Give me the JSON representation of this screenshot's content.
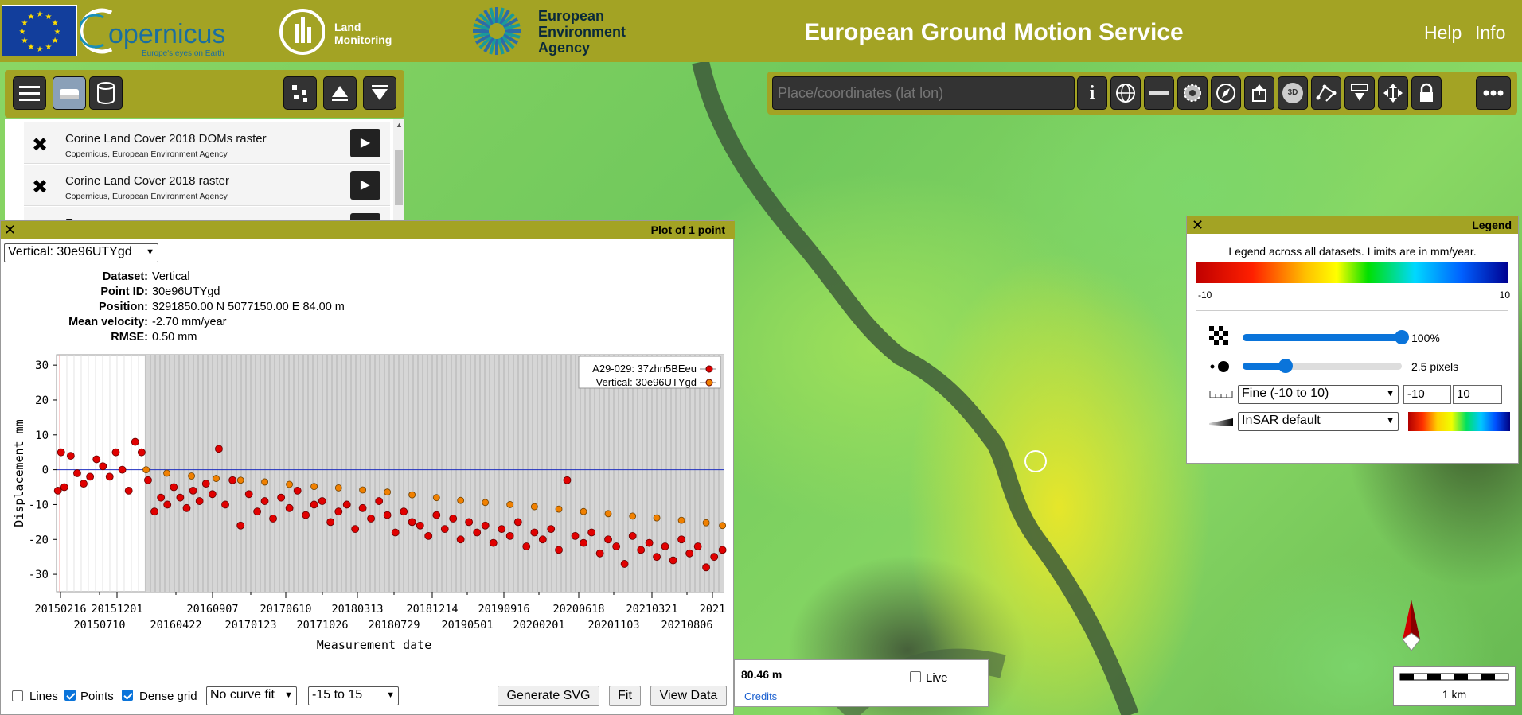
{
  "header": {
    "logo_eu": "EU",
    "logo_copernicus": "opernicus",
    "logo_copernicus_tagline": "Europe's eyes on Earth",
    "logo_land": "Land\nMonitoring",
    "logo_eea_line1": "European",
    "logo_eea_line2": "Environment",
    "logo_eea_line3": "Agency",
    "title": "European Ground Motion Service",
    "help": "Help",
    "info": "Info"
  },
  "search": {
    "placeholder": "Place/coordinates (lat lon)"
  },
  "toolbar_right": {
    "three_d_label": "3D"
  },
  "layers": [
    {
      "title": "Corine Land Cover 2018 DOMs raster",
      "source": "Copernicus, European Environment Agency"
    },
    {
      "title": "Corine Land Cover 2018 raster",
      "source": "Copernicus, European Environment Agency"
    },
    {
      "title": "Eu",
      "source": ""
    }
  ],
  "plot": {
    "title": "Plot of 1 point",
    "selected_dataset": "Vertical: 30e96UTYgd",
    "info": {
      "dataset_label": "Dataset:",
      "dataset": "Vertical",
      "point_id_label": "Point ID:",
      "point_id": "30e96UTYgd",
      "position_label": "Position:",
      "position": "3291850.00 N 5077150.00 E 84.00 m",
      "velocity_label": "Mean velocity:",
      "velocity": "-2.70 mm/year",
      "rmse_label": "RMSE:",
      "rmse": "0.50 mm"
    },
    "controls": {
      "lines_label": "Lines",
      "lines_checked": false,
      "points_label": "Points",
      "points_checked": true,
      "dense_label": "Dense grid",
      "dense_checked": true,
      "curve_fit": "No curve fit",
      "range": "-15 to 15",
      "generate_svg": "Generate SVG",
      "fit": "Fit",
      "view_data": "View Data"
    }
  },
  "chart_data": {
    "type": "scatter",
    "title": "",
    "xlabel": "Measurement date",
    "ylabel": "Displacement mm",
    "ylim": [
      -35,
      33
    ],
    "xlim": [
      "2015-01-15",
      "2021-11-05"
    ],
    "yticks": [
      30,
      20,
      10,
      0,
      -10,
      -20,
      -30
    ],
    "xticks_upper": [
      "20150216",
      "20151201",
      "20160907",
      "20170610",
      "20180313",
      "20181214",
      "20190916",
      "20200618",
      "20210321",
      "2021"
    ],
    "xticks_lower": [
      "20150710",
      "20160422",
      "20170123",
      "20171026",
      "20180729",
      "20190501",
      "20200201",
      "20201103",
      "20210806"
    ],
    "grid": true,
    "legend_position": "top-right",
    "series": [
      {
        "name": "A29-029: 37zhn5BEeu",
        "color": "#e00000",
        "points": [
          [
            "2015-01-20",
            -6
          ],
          [
            "2015-02-01",
            5
          ],
          [
            "2015-02-13",
            -5
          ],
          [
            "2015-03-09",
            4
          ],
          [
            "2015-04-02",
            -1
          ],
          [
            "2015-04-26",
            -4
          ],
          [
            "2015-05-20",
            -2
          ],
          [
            "2015-06-13",
            3
          ],
          [
            "2015-07-07",
            1
          ],
          [
            "2015-08-01",
            -2
          ],
          [
            "2015-08-24",
            5
          ],
          [
            "2015-09-17",
            0
          ],
          [
            "2015-10-11",
            -6
          ],
          [
            "2015-11-04",
            8
          ],
          [
            "2015-11-28",
            5
          ],
          [
            "2015-12-22",
            -3
          ],
          [
            "2016-01-15",
            -12
          ],
          [
            "2016-02-08",
            -8
          ],
          [
            "2016-03-03",
            -10
          ],
          [
            "2016-03-27",
            -5
          ],
          [
            "2016-04-20",
            -8
          ],
          [
            "2016-05-14",
            -11
          ],
          [
            "2016-06-07",
            -6
          ],
          [
            "2016-07-01",
            -9
          ],
          [
            "2016-07-25",
            -4
          ],
          [
            "2016-08-18",
            -7
          ],
          [
            "2016-09-11",
            6
          ],
          [
            "2016-10-05",
            -10
          ],
          [
            "2016-11-01",
            -3
          ],
          [
            "2016-12-01",
            -16
          ],
          [
            "2017-01-01",
            -7
          ],
          [
            "2017-02-01",
            -12
          ],
          [
            "2017-03-01",
            -9
          ],
          [
            "2017-04-01",
            -14
          ],
          [
            "2017-05-01",
            -8
          ],
          [
            "2017-06-01",
            -11
          ],
          [
            "2017-07-01",
            -6
          ],
          [
            "2017-08-01",
            -13
          ],
          [
            "2017-09-01",
            -10
          ],
          [
            "2017-10-01",
            -9
          ],
          [
            "2017-11-01",
            -15
          ],
          [
            "2017-12-01",
            -12
          ],
          [
            "2018-01-01",
            -10
          ],
          [
            "2018-02-01",
            -17
          ],
          [
            "2018-03-01",
            -11
          ],
          [
            "2018-04-01",
            -14
          ],
          [
            "2018-05-01",
            -9
          ],
          [
            "2018-06-01",
            -13
          ],
          [
            "2018-07-01",
            -18
          ],
          [
            "2018-08-01",
            -12
          ],
          [
            "2018-09-01",
            -15
          ],
          [
            "2018-10-01",
            -16
          ],
          [
            "2018-11-01",
            -19
          ],
          [
            "2018-12-01",
            -13
          ],
          [
            "2019-01-01",
            -17
          ],
          [
            "2019-02-01",
            -14
          ],
          [
            "2019-03-01",
            -20
          ],
          [
            "2019-04-01",
            -15
          ],
          [
            "2019-05-01",
            -18
          ],
          [
            "2019-06-01",
            -16
          ],
          [
            "2019-07-01",
            -21
          ],
          [
            "2019-08-01",
            -17
          ],
          [
            "2019-09-01",
            -19
          ],
          [
            "2019-10-01",
            -15
          ],
          [
            "2019-11-01",
            -22
          ],
          [
            "2019-12-01",
            -18
          ],
          [
            "2020-01-01",
            -20
          ],
          [
            "2020-02-01",
            -17
          ],
          [
            "2020-03-01",
            -23
          ],
          [
            "2020-04-01",
            -3
          ],
          [
            "2020-05-01",
            -19
          ],
          [
            "2020-06-01",
            -21
          ],
          [
            "2020-07-01",
            -18
          ],
          [
            "2020-08-01",
            -24
          ],
          [
            "2020-09-01",
            -20
          ],
          [
            "2020-10-01",
            -22
          ],
          [
            "2020-11-01",
            -27
          ],
          [
            "2020-12-01",
            -19
          ],
          [
            "2021-01-01",
            -23
          ],
          [
            "2021-02-01",
            -21
          ],
          [
            "2021-03-01",
            -25
          ],
          [
            "2021-04-01",
            -22
          ],
          [
            "2021-05-01",
            -26
          ],
          [
            "2021-06-01",
            -20
          ],
          [
            "2021-07-01",
            -24
          ],
          [
            "2021-08-01",
            -22
          ],
          [
            "2021-09-01",
            -28
          ],
          [
            "2021-10-01",
            -25
          ],
          [
            "2021-11-01",
            -23
          ]
        ]
      },
      {
        "name": "Vertical: 30e96UTYgd",
        "color": "#f08000",
        "points": [
          [
            "2015-12-15",
            0
          ],
          [
            "2016-03-01",
            -1
          ],
          [
            "2016-06-01",
            -1.8
          ],
          [
            "2016-09-01",
            -2.5
          ],
          [
            "2016-12-01",
            -3
          ],
          [
            "2017-03-01",
            -3.5
          ],
          [
            "2017-06-01",
            -4.2
          ],
          [
            "2017-09-01",
            -4.8
          ],
          [
            "2017-12-01",
            -5.2
          ],
          [
            "2018-03-01",
            -5.8
          ],
          [
            "2018-06-01",
            -6.4
          ],
          [
            "2018-09-01",
            -7.2
          ],
          [
            "2018-12-01",
            -8
          ],
          [
            "2019-03-01",
            -8.8
          ],
          [
            "2019-06-01",
            -9.4
          ],
          [
            "2019-09-01",
            -10
          ],
          [
            "2019-12-01",
            -10.6
          ],
          [
            "2020-03-01",
            -11.3
          ],
          [
            "2020-06-01",
            -12
          ],
          [
            "2020-09-01",
            -12.6
          ],
          [
            "2020-12-01",
            -13.3
          ],
          [
            "2021-03-01",
            -13.8
          ],
          [
            "2021-06-01",
            -14.5
          ],
          [
            "2021-09-01",
            -15.2
          ],
          [
            "2021-11-01",
            -16
          ]
        ]
      }
    ]
  },
  "legend": {
    "title": "Legend",
    "description": "Legend across all datasets. Limits are in mm/year.",
    "min": "-10",
    "max": "10",
    "opacity_label": "100%",
    "opacity_fraction": 1.0,
    "point_size_label": "2.5 pixels",
    "point_size_fraction": 0.27,
    "scale_select": "Fine (-10 to 10)",
    "limit_min": "-10",
    "limit_max": "10",
    "scheme_select": "InSAR default"
  },
  "status": {
    "distance": "80.46 m",
    "live_label": "Live",
    "credits": "Credits"
  },
  "scale": {
    "label": "1 km"
  }
}
